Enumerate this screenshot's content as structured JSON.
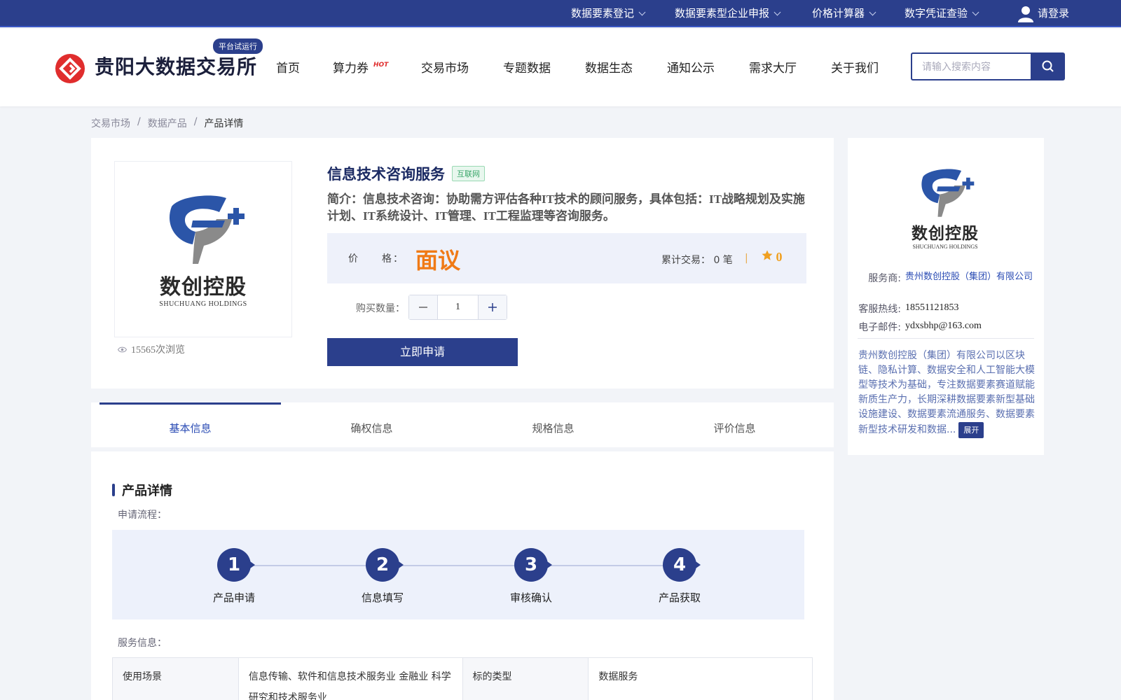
{
  "topbar": {
    "items": [
      "数据要素登记",
      "数据要素型企业申报",
      "价格计算器",
      "数字凭证查验"
    ],
    "login": "请登录"
  },
  "header": {
    "logo_text": "贵阳大数据交易所",
    "badge": "平台试运行",
    "nav": [
      "首页",
      "算力券",
      "交易市场",
      "专题数据",
      "数据生态",
      "通知公示",
      "需求大厅",
      "关于我们"
    ],
    "hot": "HOT",
    "search_placeholder": "请输入搜索内容"
  },
  "breadcrumb": [
    "交易市场",
    "数据产品",
    "产品详情"
  ],
  "product": {
    "logo_cn": "数创控股",
    "logo_en": "SHUCHUANG HOLDINGS",
    "views": "15565次浏览",
    "title": "信息技术咨询服务",
    "tag": "互联网",
    "intro": "简介：信息技术咨询：协助需方评估各种IT技术的顾问服务，具体包括：IT战略规划及实施计划、IT系统设计、IT管理、IT工程监理等咨询服务。",
    "price_label": "价　　格：",
    "price": "面议",
    "deals": "累计交易：  0 笔",
    "separator": "|",
    "rating": "0",
    "qty_label": "购买数量：",
    "qty": "1",
    "apply": "立即申请"
  },
  "provider": {
    "logo_cn": "数创控股",
    "logo_en": "SHUCHUANG HOLDINGS",
    "name_label": "服务商:",
    "name": "贵州数创控股（集团）有限公司",
    "phone_label": "客服热线:",
    "phone": "18551121853",
    "email_label": "电子邮件:",
    "email": "ydxsbhp@163.com",
    "desc": "贵州数创控股（集团）有限公司以区块链、隐私计算、数据安全和人工智能大模型等技术为基础，专注数据要素赛道赋能新质生产力，长期深耕数据要素新型基础设施建设、数据要素流通服务、数据要素新型技术研发和数据...",
    "expand": "展开"
  },
  "tabs": [
    "基本信息",
    "确权信息",
    "规格信息",
    "评价信息"
  ],
  "detail": {
    "title": "产品详情",
    "flow_label": "申请流程：",
    "steps": [
      {
        "num": "1",
        "label": "产品申请"
      },
      {
        "num": "2",
        "label": "信息填写"
      },
      {
        "num": "3",
        "label": "审核确认"
      },
      {
        "num": "4",
        "label": "产品获取"
      }
    ],
    "service_label": "服务信息：",
    "table": {
      "k1": "使用场景",
      "v1": "信息传输、软件和信息技术服务业 金融业 科学研究和技术服务业",
      "k2": "标的类型",
      "v2": "数据服务"
    }
  },
  "colors": {
    "brand": "#2b3f8c",
    "price": "#f07a16",
    "logo_red": "#e02d2d"
  }
}
